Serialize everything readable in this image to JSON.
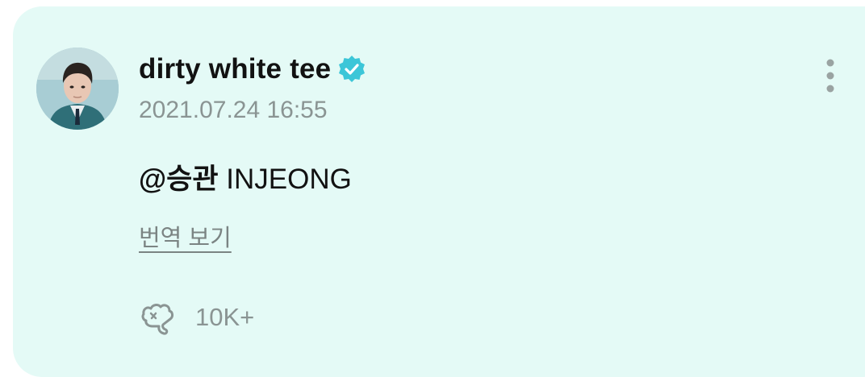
{
  "post": {
    "author_name": "dirty white tee",
    "timestamp": "2021.07.24 16:55",
    "mention": "@승관",
    "message_text": "INJEONG",
    "translate_label": "번역 보기",
    "reaction_count": "10K+"
  },
  "icons": {
    "verified": "verified-badge-icon",
    "more": "more-vertical-icon",
    "reaction": "heart-hand-reaction-icon"
  },
  "colors": {
    "card_background": "#e4faf6",
    "verified_badge": "#3cc6d8",
    "muted_text": "#8a9493"
  }
}
